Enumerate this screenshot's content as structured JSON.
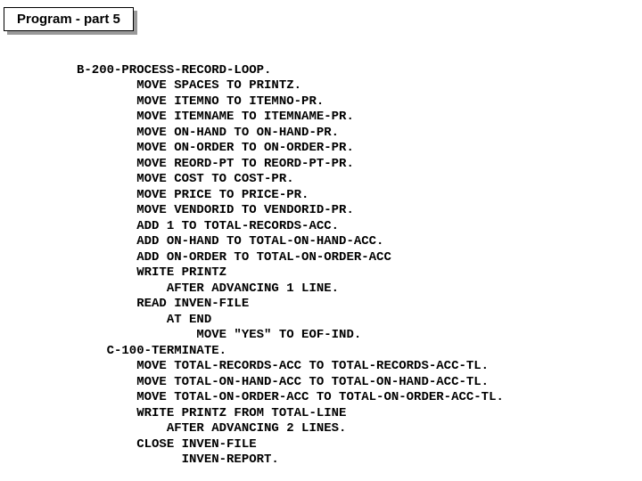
{
  "title": "Program - part 5",
  "code": {
    "l1": "B-200-PROCESS-RECORD-LOOP.",
    "l2": "        MOVE SPACES TO PRINTZ.",
    "l3": "        MOVE ITEMNO TO ITEMNO-PR.",
    "l4": "        MOVE ITEMNAME TO ITEMNAME-PR.",
    "l5": "        MOVE ON-HAND TO ON-HAND-PR.",
    "l6": "        MOVE ON-ORDER TO ON-ORDER-PR.",
    "l7": "        MOVE REORD-PT TO REORD-PT-PR.",
    "l8": "        MOVE COST TO COST-PR.",
    "l9": "        MOVE PRICE TO PRICE-PR.",
    "l10": "        MOVE VENDORID TO VENDORID-PR.",
    "l11": "        ADD 1 TO TOTAL-RECORDS-ACC.",
    "l12": "        ADD ON-HAND TO TOTAL-ON-HAND-ACC.",
    "l13": "        ADD ON-ORDER TO TOTAL-ON-ORDER-ACC",
    "l14": "        WRITE PRINTZ",
    "l15": "            AFTER ADVANCING 1 LINE.",
    "l16": "        READ INVEN-FILE",
    "l17": "            AT END",
    "l18": "                MOVE \"YES\" TO EOF-IND.",
    "l19": "    C-100-TERMINATE.",
    "l20": "        MOVE TOTAL-RECORDS-ACC TO TOTAL-RECORDS-ACC-TL.",
    "l21": "        MOVE TOTAL-ON-HAND-ACC TO TOTAL-ON-HAND-ACC-TL.",
    "l22": "        MOVE TOTAL-ON-ORDER-ACC TO TOTAL-ON-ORDER-ACC-TL.",
    "l23": "        WRITE PRINTZ FROM TOTAL-LINE",
    "l24": "            AFTER ADVANCING 2 LINES.",
    "l25": "        CLOSE INVEN-FILE",
    "l26": "              INVEN-REPORT."
  }
}
